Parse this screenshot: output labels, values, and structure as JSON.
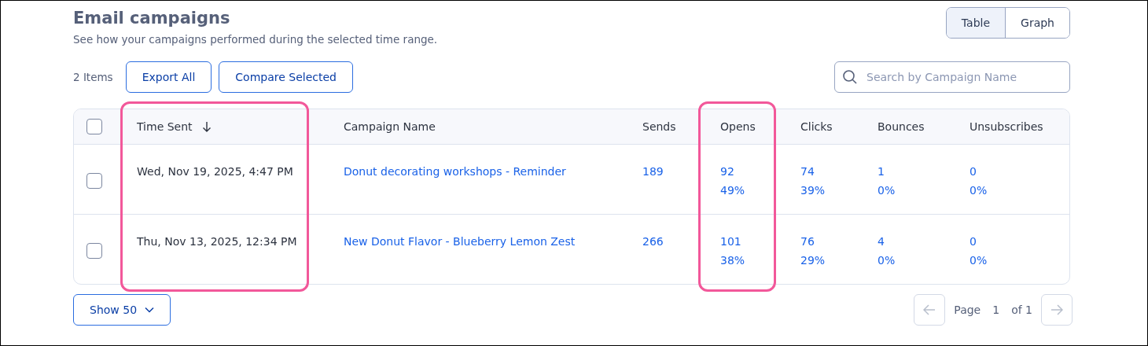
{
  "header": {
    "title": "Email campaigns",
    "subtitle": "See how your campaigns performed during the selected time range."
  },
  "view_toggle": [
    {
      "label": "Table",
      "selected": true
    },
    {
      "label": "Graph",
      "selected": false
    }
  ],
  "toolbar": {
    "item_count": "2 Items",
    "buttons": [
      "Export All",
      "Compare Selected"
    ],
    "search": {
      "placeholder": "Search by Campaign Name"
    }
  },
  "table": {
    "select_all": {
      "checked": false
    },
    "columns": [
      {
        "label": "Time Sent",
        "kind": "text",
        "sorted": true,
        "highlighted": true
      },
      {
        "label": "Campaign Name",
        "kind": "link",
        "sorted": false,
        "highlighted": false
      },
      {
        "label": "Sends",
        "kind": "link",
        "sorted": false,
        "highlighted": false
      },
      {
        "label": "Opens",
        "kind": "link",
        "sorted": false,
        "highlighted": true
      },
      {
        "label": "Clicks",
        "kind": "link",
        "sorted": false,
        "highlighted": false
      },
      {
        "label": "Bounces",
        "kind": "link",
        "sorted": false,
        "highlighted": false
      },
      {
        "label": "Unsubscribes",
        "kind": "link",
        "sorted": false,
        "highlighted": false
      }
    ],
    "rows": [
      {
        "checked": false,
        "cells": [
          [
            "Wed, Nov 19, 2025, 4:47 PM"
          ],
          [
            "Donut decorating workshops - Reminder"
          ],
          [
            "189"
          ],
          [
            "92",
            "49%"
          ],
          [
            "74",
            "39%"
          ],
          [
            "1",
            "0%"
          ],
          [
            "0",
            "0%"
          ]
        ]
      },
      {
        "checked": false,
        "cells": [
          [
            "Thu, Nov 13, 2025, 12:34 PM"
          ],
          [
            "New Donut Flavor - Blueberry Lemon Zest"
          ],
          [
            "266"
          ],
          [
            "101",
            "38%"
          ],
          [
            "76",
            "29%"
          ],
          [
            "4",
            "0%"
          ],
          [
            "0",
            "0%"
          ]
        ]
      }
    ]
  },
  "footer": {
    "page_size": "Show 50",
    "page_label": "Page",
    "page_number": "1",
    "page_total": "of 1",
    "prev_disabled": true,
    "next_disabled": true
  }
}
